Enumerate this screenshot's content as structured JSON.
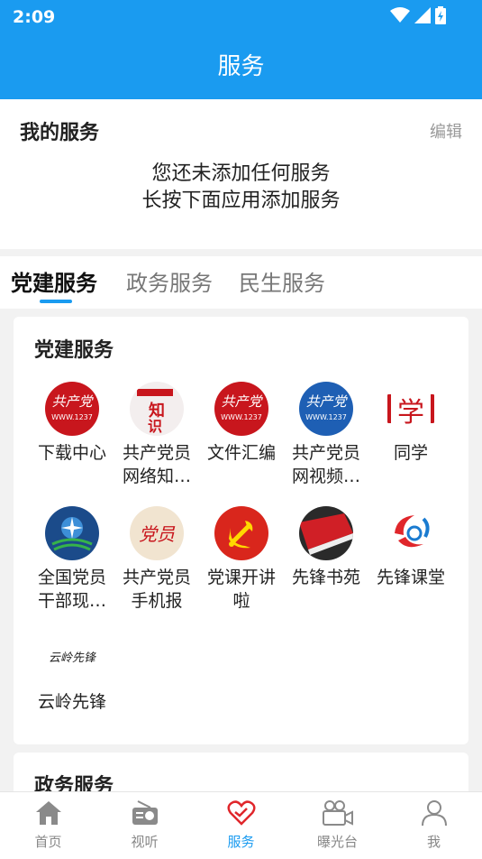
{
  "status": {
    "time": "2:09"
  },
  "appbar": {
    "title": "服务"
  },
  "my_services": {
    "title": "我的服务",
    "edit_label": "编辑",
    "empty_line1": "您还未添加任何服务",
    "empty_line2": "长按下面应用添加服务"
  },
  "tabs": [
    {
      "label": "党建服务",
      "active": true
    },
    {
      "label": "政务服务",
      "active": false
    },
    {
      "label": "民生服务",
      "active": false
    }
  ],
  "party_section": {
    "title": "党建服务",
    "items": [
      {
        "label": "下载中心",
        "icon": "gongchandangyuan-logo-icon"
      },
      {
        "label": "共产党员网络知…",
        "icon": "zhishi-quiz-icon"
      },
      {
        "label": "文件汇编",
        "icon": "gongchandangyuan-logo-icon"
      },
      {
        "label": "共产党员网视频…",
        "icon": "gongchandangyuan-blue-logo-icon"
      },
      {
        "label": "同学",
        "icon": "xue-study-icon"
      },
      {
        "label": "全国党员干部现…",
        "icon": "remote-education-globe-icon"
      },
      {
        "label": "共产党员手机报",
        "icon": "mobile-newspaper-icon"
      },
      {
        "label": "党课开讲啦",
        "icon": "party-emblem-icon"
      },
      {
        "label": "先锋书苑",
        "icon": "red-book-icon"
      },
      {
        "label": "先锋课堂",
        "icon": "pioneer-classroom-icon"
      },
      {
        "label": "云岭先锋",
        "icon": "yunling-calligraphy-icon"
      }
    ]
  },
  "gov_section": {
    "title": "政务服务"
  },
  "bottom_nav": [
    {
      "label": "首页",
      "icon": "home-icon",
      "active": false
    },
    {
      "label": "视听",
      "icon": "radio-icon",
      "active": false
    },
    {
      "label": "服务",
      "icon": "heart-service-icon",
      "active": true
    },
    {
      "label": "曝光台",
      "icon": "video-camera-icon",
      "active": false
    },
    {
      "label": "我",
      "icon": "person-icon",
      "active": false
    }
  ],
  "colors": {
    "accent": "#1a9bf0",
    "party_red": "#c8161d"
  }
}
